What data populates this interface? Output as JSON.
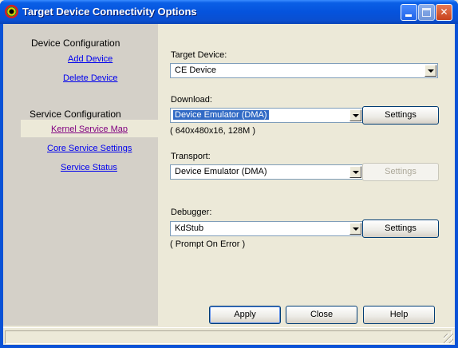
{
  "window": {
    "title": "Target Device Connectivity Options",
    "icon": "app-icon",
    "controls": [
      "minimize",
      "maximize",
      "close"
    ]
  },
  "sidebar": {
    "device_config": {
      "title": "Device Configuration",
      "items": [
        {
          "label": "Add Device"
        },
        {
          "label": "Delete Device"
        }
      ]
    },
    "service_config": {
      "title": "Service Configuration",
      "items": [
        {
          "label": "Kernel Service Map",
          "selected": true
        },
        {
          "label": "Core Service Settings"
        },
        {
          "label": "Service Status"
        }
      ]
    }
  },
  "form": {
    "target_device": {
      "label": "Target Device:",
      "value": "CE Device"
    },
    "download": {
      "label": "Download:",
      "value": "Device Emulator (DMA)",
      "info": "( 640x480x16, 128M )",
      "settings_label": "Settings"
    },
    "transport": {
      "label": "Transport:",
      "value": "Device Emulator (DMA)",
      "settings_label": "Settings",
      "settings_enabled": false
    },
    "debugger": {
      "label": "Debugger:",
      "value": "KdStub",
      "info": "( Prompt On Error )",
      "settings_label": "Settings"
    }
  },
  "buttons": {
    "apply": "Apply",
    "close": "Close",
    "help": "Help"
  }
}
